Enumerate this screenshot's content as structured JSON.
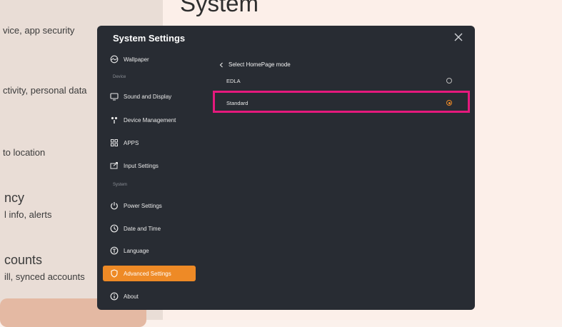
{
  "background": {
    "title": "System",
    "lines": [
      "vice, app security",
      "ctivity, personal data",
      "to location",
      "ncy",
      "l info, alerts",
      "counts",
      "ill, synced accounts"
    ]
  },
  "dialog": {
    "title": "System Settings",
    "close_icon": "close-icon"
  },
  "sidebar": {
    "sections": [
      "Device",
      "System"
    ],
    "items": [
      {
        "label": "Wallpaper",
        "icon": "wallpaper-icon"
      },
      {
        "label": "Sound and Display",
        "icon": "display-icon"
      },
      {
        "label": "Device Management",
        "icon": "device-management-icon"
      },
      {
        "label": "APPS",
        "icon": "apps-icon"
      },
      {
        "label": "Input Settings",
        "icon": "input-icon"
      },
      {
        "label": "Power Settings",
        "icon": "power-icon"
      },
      {
        "label": "Date and Time",
        "icon": "clock-icon"
      },
      {
        "label": "Language",
        "icon": "language-icon"
      },
      {
        "label": "Advanced Settings",
        "icon": "shield-icon",
        "active": true
      },
      {
        "label": "About",
        "icon": "info-icon"
      }
    ]
  },
  "content": {
    "back_label": "Select HomePage mode",
    "options": [
      {
        "label": "EDLA",
        "selected": false
      },
      {
        "label": "Standard",
        "selected": true
      }
    ]
  },
  "colors": {
    "accent": "#ee8a26",
    "dialog_bg": "#282c33",
    "highlight": "#e5197d"
  }
}
